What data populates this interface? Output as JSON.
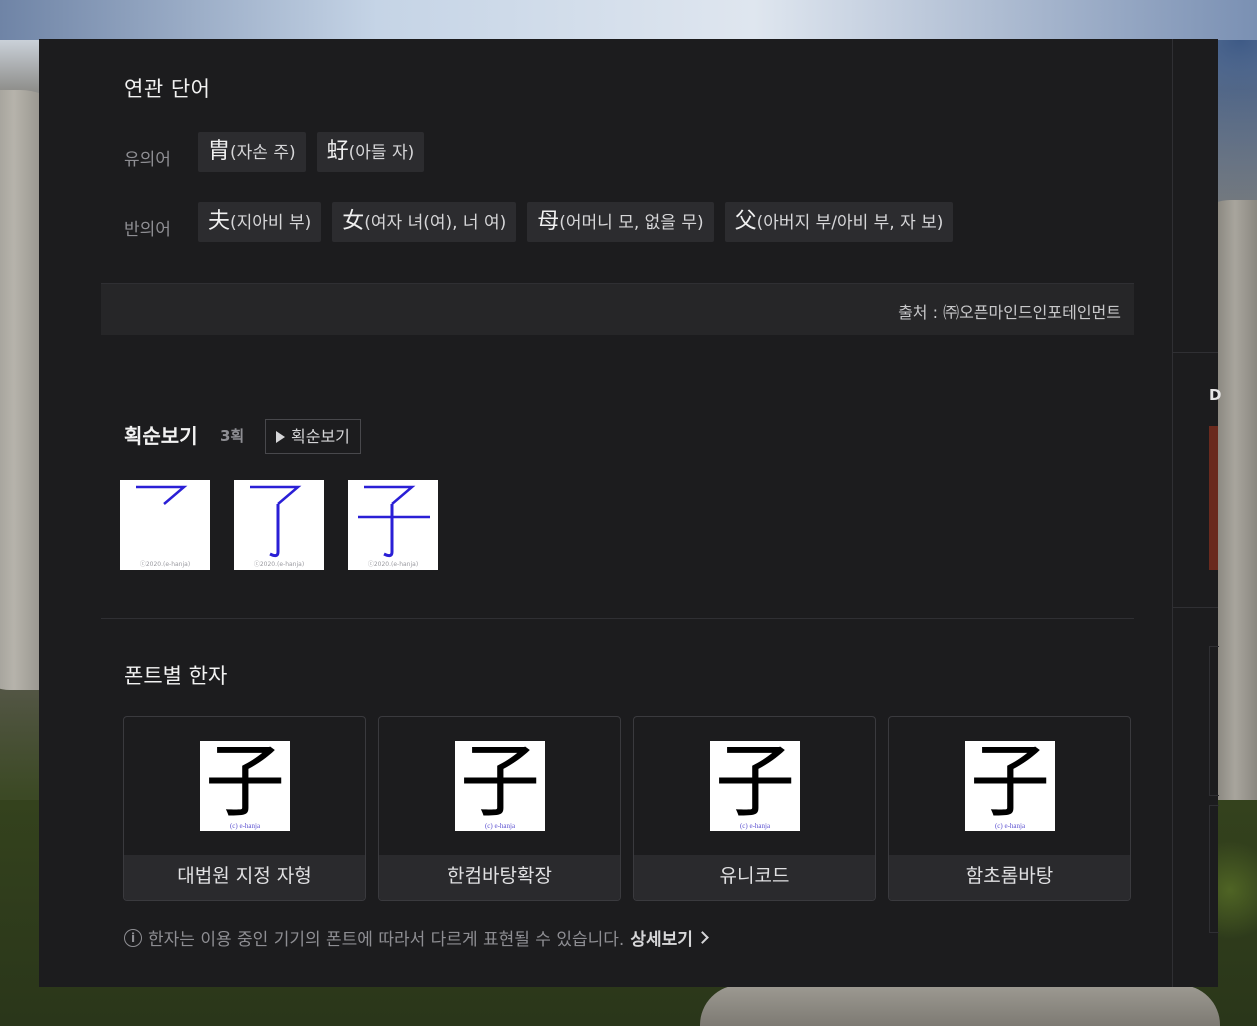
{
  "related": {
    "title": "연관 단어",
    "synonym_label": "유의어",
    "antonym_label": "반의어",
    "synonyms": [
      {
        "hanja": "胄",
        "reading": "(자손 주)"
      },
      {
        "hanja": "虸",
        "reading": "(아들 자)"
      }
    ],
    "antonyms": [
      {
        "hanja": "夫",
        "reading": "(지아비 부)"
      },
      {
        "hanja": "女",
        "reading": "(여자 녀(여), 너 여)"
      },
      {
        "hanja": "母",
        "reading": "(어머니 모, 없을 무)"
      },
      {
        "hanja": "父",
        "reading": "(아버지 부/아비 부, 자 보)"
      }
    ],
    "source": "출처 : ㈜오픈마인드인포테인먼트"
  },
  "stroke": {
    "title": "획순보기",
    "count": "3획",
    "button_label": "획순보기",
    "watermark": "ⓒ2020.(e-hanja)",
    "colors": {
      "stroke": "#2a1fd6"
    }
  },
  "fonts": {
    "title": "폰트별 한자",
    "glyph": "子",
    "caption": "(c) e-hanja",
    "cards": [
      {
        "label": "대법원 지정 자형"
      },
      {
        "label": "한컴바탕확장"
      },
      {
        "label": "유니코드"
      },
      {
        "label": "함초롬바탕"
      }
    ],
    "notice": "한자는 이용 중인 기기의 폰트에 따라서 다르게 표현될 수 있습니다.",
    "detail_link": "상세보기"
  },
  "sidebar": {
    "letter": "D"
  }
}
